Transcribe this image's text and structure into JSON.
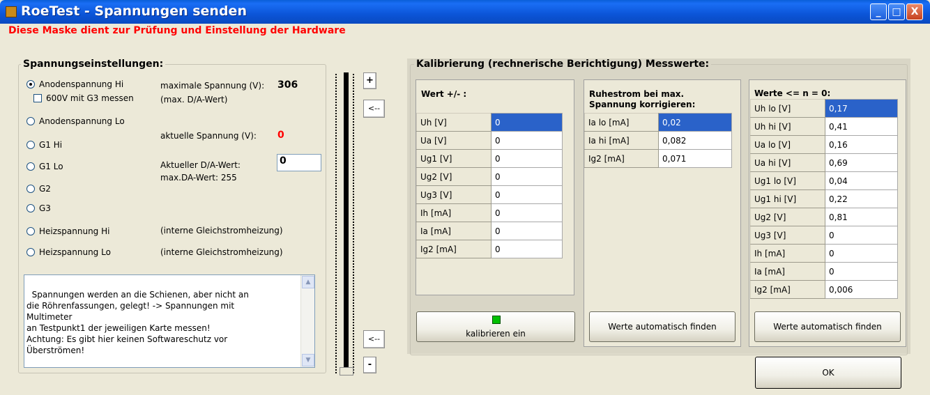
{
  "window": {
    "title": "RoeTest - Spannungen senden",
    "minimize": "_",
    "maximize": "□",
    "close": "X"
  },
  "subtitle": "Diese Maske dient zur Prüfung und Einstellung der Hardware",
  "spannung": {
    "legend": "Spannungseinstellungen:",
    "options": [
      {
        "label": "Anodenspannung Hi",
        "checked": true
      },
      {
        "label": "Anodenspannung Lo",
        "checked": false
      },
      {
        "label": "G1 Hi",
        "checked": false
      },
      {
        "label": "G1 Lo",
        "checked": false
      },
      {
        "label": "G2",
        "checked": false
      },
      {
        "label": "G3",
        "checked": false
      },
      {
        "label": "Heizspannung Hi",
        "checked": false
      },
      {
        "label": "Heizspannung Lo",
        "checked": false
      }
    ],
    "g3_checkbox": "600V mit G3 messen",
    "max_label": "maximale Spannung (V):",
    "max_value": "306",
    "max_da_label": "(max. D/A-Wert)",
    "akt_label": "aktuelle Spannung (V):",
    "akt_value": "0",
    "da_label": "Aktueller D/A-Wert:",
    "da_value": "0",
    "max_da_wert": "max.DA-Wert: 255",
    "heiz_hi_note": "(interne Gleichstromheizung)",
    "heiz_lo_note": "(interne Gleichstromheizung)",
    "memo": "Spannungen werden an die Schienen, aber nicht an\ndie Röhrenfassungen, gelegt! -> Spannungen mit\nMultimeter\nan Testpunkt1 der jeweiligen Karte messen!\nAchtung: Es gibt hier keinen Softwareschutz vor\nÜberströmen!",
    "plus": "+",
    "minus": "-",
    "back_top": "<--",
    "back_bottom": "<--",
    "slider_level": 0
  },
  "kalib": {
    "legend": "Kalibrierung (rechnerische Berichtigung) Messwerte:",
    "wert_label": "Wert +/- :",
    "wert_rows": [
      {
        "k": "Uh   [V]",
        "v": "0"
      },
      {
        "k": "Ua   [V]",
        "v": "0"
      },
      {
        "k": "Ug1  [V]",
        "v": "0"
      },
      {
        "k": "Ug2  [V]",
        "v": "0"
      },
      {
        "k": "Ug3  [V]",
        "v": "0"
      },
      {
        "k": "Ih    [mA]",
        "v": "0"
      },
      {
        "k": "Ia    [mA]",
        "v": "0"
      },
      {
        "k": "Ig2  [mA]",
        "v": "0"
      }
    ],
    "ruhe_label": "Ruhestrom bei max. Spannung korrigieren:",
    "ruhe_rows": [
      {
        "k": "Ia lo [mA]",
        "v": "0,02"
      },
      {
        "k": "Ia hi [mA]",
        "v": "0,082"
      },
      {
        "k": "Ig2   [mA]",
        "v": "0,071"
      }
    ],
    "n_label": "Werte <= n = 0:",
    "n_rows": [
      {
        "k": "Uh lo  [V]",
        "v": "0,17"
      },
      {
        "k": "Uh hi  [V]",
        "v": "0,41"
      },
      {
        "k": "Ua lo  [V]",
        "v": "0,16"
      },
      {
        "k": "Ua hi  [V]",
        "v": "0,69"
      },
      {
        "k": "Ug1 lo [V]",
        "v": "0,04"
      },
      {
        "k": "Ug1 hi [V]",
        "v": "0,22"
      },
      {
        "k": "Ug2     [V]",
        "v": "0,81"
      },
      {
        "k": "Ug3     [V]",
        "v": "0"
      },
      {
        "k": "Ih        [mA]",
        "v": "0"
      },
      {
        "k": "Ia        [mA]",
        "v": "0"
      },
      {
        "k": "Ig2      [mA]",
        "v": "0,006"
      }
    ],
    "kalib_btn": "kalibrieren ein",
    "auto_btn1": "Werte automatisch finden",
    "auto_btn2": "Werte automatisch finden",
    "ok_btn": "OK"
  }
}
